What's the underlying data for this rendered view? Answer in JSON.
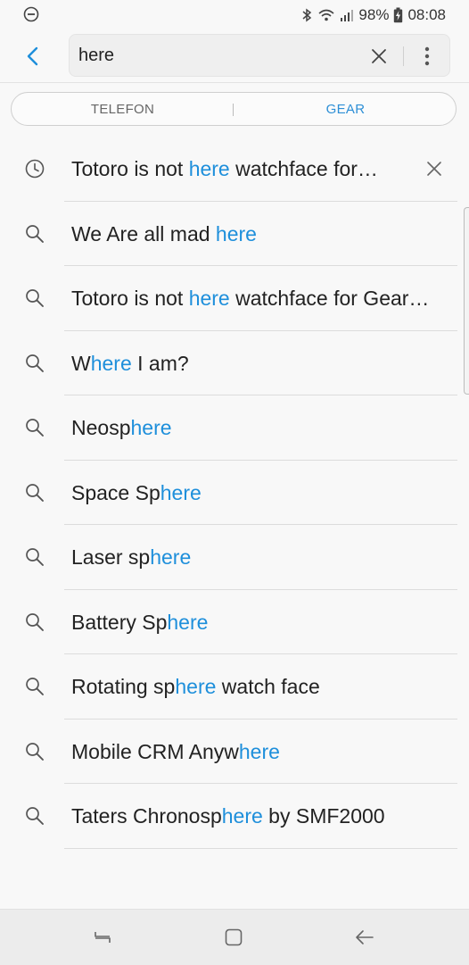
{
  "status": {
    "battery": "98%",
    "time": "08:08"
  },
  "search": {
    "query": "here"
  },
  "tabs": {
    "left": "TELEFON",
    "right": "GEAR",
    "active": "right"
  },
  "results": [
    {
      "type": "history",
      "pre": "Totoro is not ",
      "hl": "here",
      "post": " watchface for…"
    },
    {
      "type": "suggestion",
      "pre": "We Are all mad ",
      "hl": "here",
      "post": ""
    },
    {
      "type": "suggestion",
      "pre": "Totoro is not ",
      "hl": "here",
      "post": " watchface for Gear…"
    },
    {
      "type": "suggestion",
      "pre": "W",
      "hl": "here",
      "post": " I am?"
    },
    {
      "type": "suggestion",
      "pre": "Neosp",
      "hl": "here",
      "post": ""
    },
    {
      "type": "suggestion",
      "pre": "Space Sp",
      "hl": "here",
      "post": ""
    },
    {
      "type": "suggestion",
      "pre": "Laser sp",
      "hl": "here",
      "post": ""
    },
    {
      "type": "suggestion",
      "pre": "Battery Sp",
      "hl": "here",
      "post": ""
    },
    {
      "type": "suggestion",
      "pre": "Rotating sp",
      "hl": "here",
      "post": " watch face"
    },
    {
      "type": "suggestion",
      "pre": "Mobile CRM Anyw",
      "hl": "here",
      "post": ""
    },
    {
      "type": "suggestion",
      "pre": "Taters Chronosp",
      "hl": "here",
      "post": " by SMF2000"
    }
  ],
  "colors": {
    "accent": "#1e8fdb",
    "text": "#222222",
    "background": "#f8f8f8"
  }
}
